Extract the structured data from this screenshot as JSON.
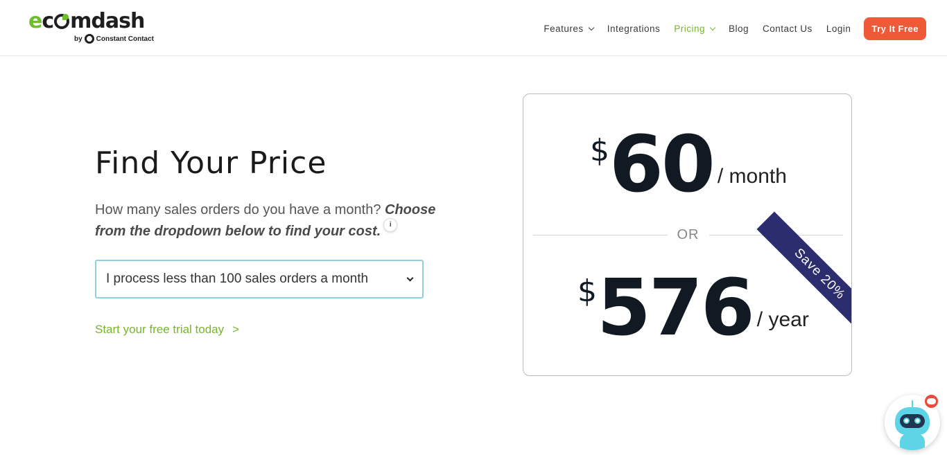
{
  "brand": {
    "name_prefix": "e",
    "name_mid": "c",
    "name_suffix": "mdash",
    "by_text": "by",
    "partner": "Constant Contact"
  },
  "nav": {
    "items": [
      {
        "label": "Features",
        "has_dropdown": true,
        "active": false
      },
      {
        "label": "Integrations",
        "has_dropdown": false,
        "active": false
      },
      {
        "label": "Pricing",
        "has_dropdown": true,
        "active": true
      },
      {
        "label": "Blog",
        "has_dropdown": false,
        "active": false
      },
      {
        "label": "Contact Us",
        "has_dropdown": false,
        "active": false
      },
      {
        "label": "Login",
        "has_dropdown": false,
        "active": false
      }
    ],
    "cta_label": "Try It Free"
  },
  "main": {
    "title": "Find Your Price",
    "question_plain": "How many sales orders do you have a month? ",
    "question_emphasis": "Choose from the dropdown below to find your cost.",
    "info_icon_text": "i",
    "order_select_value": "I process less than 100 sales orders a month",
    "trial_link": "Start your free trial today",
    "trial_arrow": ">"
  },
  "pricing": {
    "currency": "$",
    "monthly_amount": "60",
    "monthly_period": "/ month",
    "separator": "OR",
    "yearly_amount": "576",
    "yearly_period": "/ year",
    "ribbon": "Save 20%"
  },
  "colors": {
    "accent_green": "#77b52b",
    "cta_orange": "#ee5a37",
    "ribbon_navy": "#2b2d6e",
    "select_border": "#8fd1da"
  },
  "icons": {
    "nav_dropdown": "chevron-down-icon",
    "select_dropdown": "chevron-down-icon",
    "info": "info-icon",
    "chat": "chatbot-icon",
    "chat_badge": "chat-bubble-icon"
  }
}
